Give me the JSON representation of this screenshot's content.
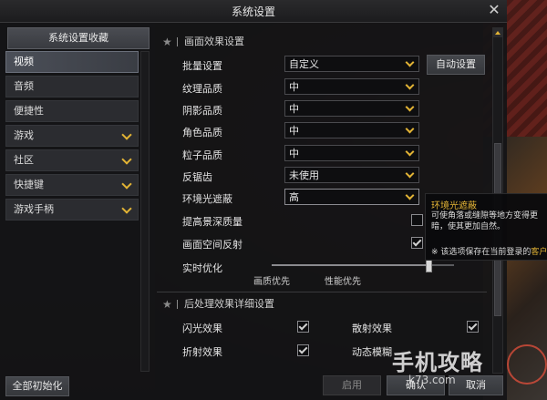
{
  "window": {
    "title": "系统设置",
    "close": "✕"
  },
  "sidebar": {
    "favorites_label": "系统设置收藏",
    "items": [
      {
        "label": "视频",
        "active": true,
        "expandable": false
      },
      {
        "label": "音频",
        "active": false,
        "expandable": false
      },
      {
        "label": "便捷性",
        "active": false,
        "expandable": false
      },
      {
        "label": "游戏",
        "active": false,
        "expandable": true
      },
      {
        "label": "社区",
        "active": false,
        "expandable": true
      },
      {
        "label": "快捷键",
        "active": false,
        "expandable": true
      },
      {
        "label": "游戏手柄",
        "active": false,
        "expandable": true
      }
    ],
    "reset_label": "全部初始化"
  },
  "graphics": {
    "section_title": "画面效果设置",
    "batch": {
      "label": "批量设置",
      "value": "自定义",
      "auto_label": "自动设置"
    },
    "rows": [
      {
        "label": "纹理品质",
        "value": "中"
      },
      {
        "label": "阴影品质",
        "value": "中"
      },
      {
        "label": "角色品质",
        "value": "中"
      },
      {
        "label": "粒子品质",
        "value": "中"
      },
      {
        "label": "反锯齿",
        "value": "未使用"
      },
      {
        "label": "环境光遮蔽",
        "value": "高"
      }
    ],
    "depth_quality": {
      "label": "提高景深质量",
      "checked": false
    },
    "ssr": {
      "label": "画面空间反射",
      "checked": true
    },
    "optimize": {
      "label": "实时优化",
      "left_label": "画质优先",
      "right_label": "性能优先",
      "level": 0.86
    }
  },
  "postprocess": {
    "section_title": "后处理效果详细设置",
    "items": [
      {
        "label": "闪光效果",
        "checked": true
      },
      {
        "label": "散射效果",
        "checked": true
      },
      {
        "label": "折射效果",
        "checked": true
      },
      {
        "label": "动态模糊",
        "checked": false
      }
    ]
  },
  "tooltip": {
    "title": "环境光遮蔽",
    "body": "可使角落或缝隙等地方变得更暗，使其更加自然。",
    "note_prefix": "※ 该选项保存在当前登录的",
    "note_highlight": "客户端",
    "note_suffix": "。"
  },
  "footer": {
    "apply_label": "启用",
    "ok_label": "确认",
    "cancel_label": "取消"
  },
  "watermark": {
    "main": "手机攻略",
    "sub": "k73.com"
  }
}
